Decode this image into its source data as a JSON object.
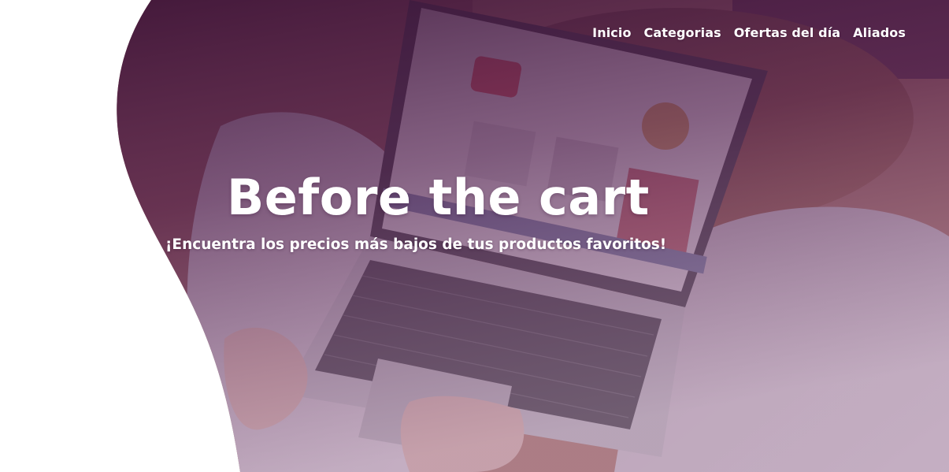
{
  "nav": {
    "items": [
      {
        "label": "Inicio"
      },
      {
        "label": "Categorias"
      },
      {
        "label": "Ofertas del día"
      },
      {
        "label": "Aliados"
      }
    ]
  },
  "hero": {
    "title": "Before the cart",
    "subtitle": "¡Encuentra los precios más bajos de tus productos favoritos!",
    "image": "laptop-on-lap-photo",
    "overlay_color": "#5a2a5a"
  },
  "colors": {
    "background": "#ffffff",
    "text": "#ffffff",
    "overlay_dark": "#3a1238",
    "overlay_light": "#b99ab8"
  }
}
